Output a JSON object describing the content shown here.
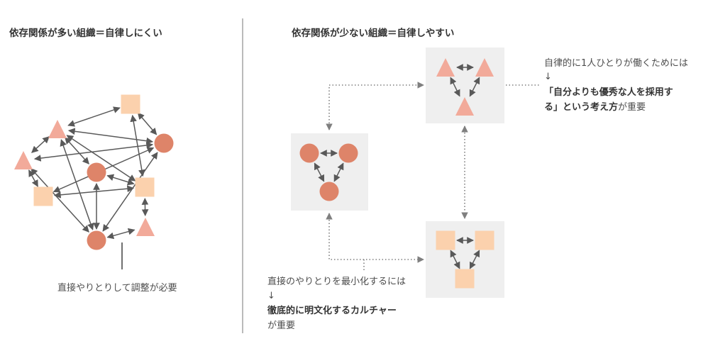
{
  "left_title": "依存関係が多い組織＝自律しにくい",
  "right_title": "依存関係が少ない組織＝自律しやすい",
  "left_note": "直接やりとりして調整が必要",
  "top_note": {
    "line1": "自律的に1人ひとりが働くためには",
    "arrow": "↓",
    "line2": "「自分よりも優秀な人を採用す",
    "line3_bold": "る」という考え方",
    "line3_rest": "が重要"
  },
  "bottom_note": {
    "line1": "直接のやりとりを最小化するには",
    "arrow": "↓",
    "line2": "徹底的に明文化するカルチャー",
    "line3": "が重要"
  },
  "colors": {
    "circle": "#de8469",
    "triangle": "#f2aa9a",
    "square": "#fbd1ad",
    "arrow": "#595959",
    "panel": "#efefef",
    "divider": "#8c8c8c",
    "dotted": "#7f7f7f"
  }
}
